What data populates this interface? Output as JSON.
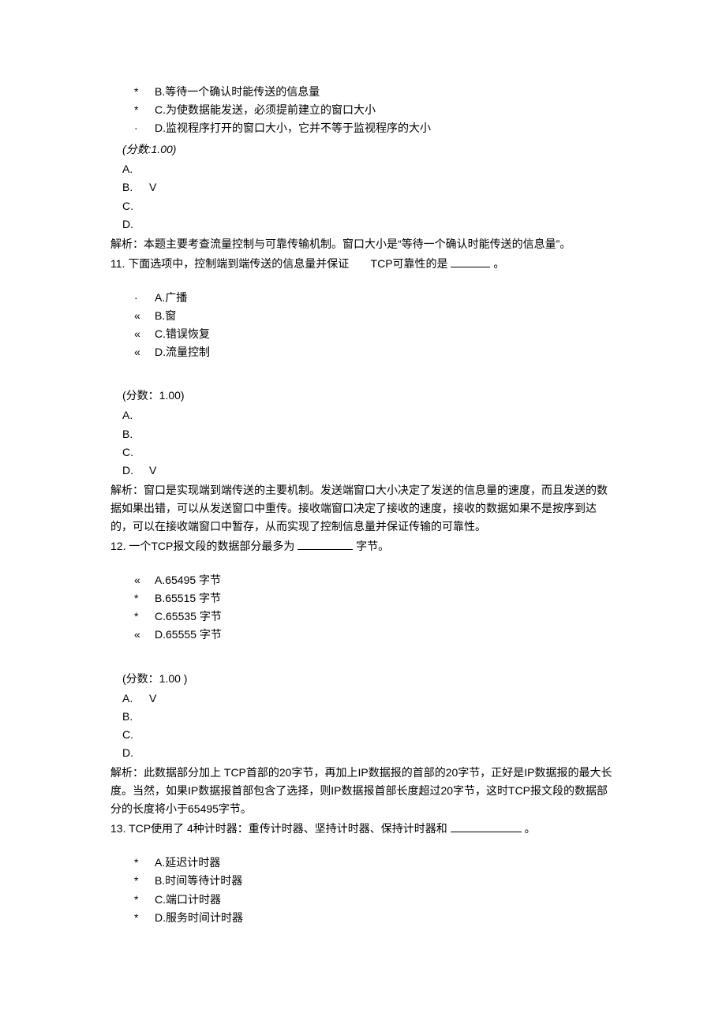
{
  "q10_tail_options": {
    "b": {
      "marker": "*",
      "text": "B.等待一个确认时能传送的信息量"
    },
    "c": {
      "marker": "*",
      "text": "C.为使数据能发送，必须提前建立的窗口大小"
    },
    "d": {
      "marker": "·",
      "text": "D.监视程序打开的窗口大小，它并不等于监视程序的大小"
    }
  },
  "q10": {
    "score": "(分数:1.00)",
    "ans": {
      "a": "A.",
      "b": "B.",
      "c": "C.",
      "d": "D.",
      "correct": "V"
    },
    "explain": "解析：本题主要考查流量控制与可靠传输机制。窗口大小是“等待一个确认时能传送的信息量”。"
  },
  "q11": {
    "stem_prefix": "11.  下面选项中，控制端到端传送的信息量并保证",
    "stem_mid": "TCP可靠性的是",
    "stem_suffix": "。",
    "opts": {
      "a": {
        "marker": "·",
        "text": "A.广播"
      },
      "b": {
        "marker": "«",
        "text": "B.窗"
      },
      "c": {
        "marker": "«",
        "text": "C.错误恢复"
      },
      "d": {
        "marker": "«",
        "text": "D.流量控制"
      }
    },
    "score": "(分数：1.00)",
    "ans": {
      "a": "A.",
      "b": "B.",
      "c": "C.",
      "d": "D.",
      "correct": "V"
    },
    "explain": "解析：窗口是实现端到端传送的主要机制。发送端窗口大小决定了发送的信息量的速度，而且发送的数据如果出错，可以从发送窗口中重传。接收端窗口决定了接收的速度，接收的数据如果不是按序到达的，可以在接收端窗口中暂存，从而实现了控制信息量并保证传输的可靠性。"
  },
  "q12": {
    "stem_prefix": "12.  一个TCP报文段的数据部分最多为",
    "stem_suffix": "字节。",
    "opts": {
      "a": {
        "marker": "«",
        "text": "A.65495 字节"
      },
      "b": {
        "marker": "*",
        "text": "B.65515 字节"
      },
      "c": {
        "marker": "*",
        "text": "C.65535 字节"
      },
      "d": {
        "marker": "«",
        "text": "D.65555 字节"
      }
    },
    "score": "(分数：1.00 )",
    "ans": {
      "a": "A.",
      "b": "B.",
      "c": "C.",
      "d": "D.",
      "correct": "V"
    },
    "explain": "解析：此数据部分加上 TCP首部的20字节，再加上IP数据报的首部的20字节，正好是IP数据报的最大长度。当然，如果IP数据报首部包含了选择，则IP数据报首部长度超过20字节，这时TCP报文段的数据部分的长度将小于65495字节。"
  },
  "q13": {
    "stem_prefix": "13.  TCP使用了 4种计时器：重传计时器、坚持计时器、保持计时器和",
    "stem_suffix": "。",
    "opts": {
      "a": {
        "marker": "*",
        "text": "A.延迟计时器"
      },
      "b": {
        "marker": "*",
        "text": "B.时间等待计时器"
      },
      "c": {
        "marker": "*",
        "text": "C.端口计时器"
      },
      "d": {
        "marker": "*",
        "text": "D.服务时间计时器"
      }
    }
  }
}
